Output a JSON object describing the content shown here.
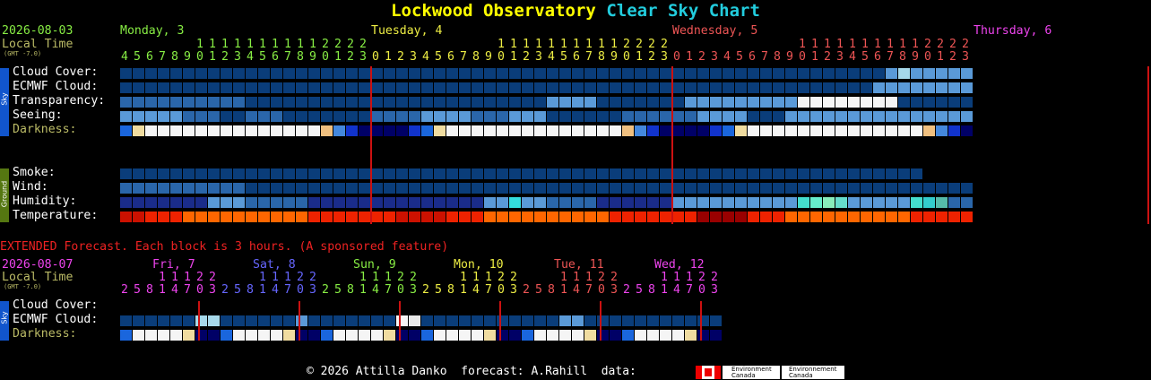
{
  "title": {
    "site": "Lockwood Observatory",
    "suffix": "Clear Sky Chart"
  },
  "main": {
    "date": "2026-08-03",
    "local_time_label": "Local Time",
    "gmt": "(GMT -7.0)",
    "days": [
      {
        "label": "Monday, 3",
        "color": "#88ee44"
      },
      {
        "label": "Tuesday, 4",
        "color": "#eeee44"
      },
      {
        "label": "Wednesday, 5",
        "color": "#ee5555"
      },
      {
        "label": "Thursday, 6",
        "color": "#ee44ee"
      }
    ],
    "hour_start": 4,
    "hour_count": 68,
    "sky_rows": [
      "Cloud Cover:",
      "ECMWF Cloud:",
      "Transparency:",
      "Seeing:",
      "Darkness:"
    ],
    "ground_rows": [
      "Smoke:",
      "Wind:",
      "Humidity:",
      "Temperature:"
    ],
    "sky_side": "Sky",
    "ground_side": "Ground"
  },
  "extended": {
    "heading": "EXTENDED Forecast. Each block is 3 hours. (A sponsored feature)",
    "date": "2026-08-07",
    "local_time_label": "Local Time",
    "gmt": "(GMT -7.0)",
    "days": [
      {
        "label": "Fri, 7",
        "color": "#ee44ee"
      },
      {
        "label": "Sat, 8",
        "color": "#6666ff"
      },
      {
        "label": "Sun, 9",
        "color": "#88ee44"
      },
      {
        "label": "Mon, 10",
        "color": "#eeee44"
      },
      {
        "label": "Tue, 11",
        "color": "#ee5555"
      },
      {
        "label": "Wed, 12",
        "color": "#ee44ee"
      }
    ],
    "hours": [
      "2",
      "5",
      "8",
      "11",
      "14",
      "17",
      "20",
      "23"
    ],
    "rows": [
      "Cloud Cover:",
      "ECMWF Cloud:",
      "Darkness:"
    ],
    "side": "Sky"
  },
  "footer": {
    "text": "© 2026 Attilla Danko  forecast: A.Rahill  data:",
    "logo1": "Environment\nCanada",
    "logo2": "Environnement\nCanada"
  },
  "colors": {
    "title_site": "#ffff00",
    "title_suffix": "#22ccdd",
    "date": "#88ee44",
    "label": "#ffffff",
    "darkness_label": "#bbbb66",
    "local_time": "#bbbb66",
    "midnight_line": "#cc1111",
    "extended_heading": "#ee2222",
    "sky_bar": "#1155cc",
    "ground_bar": "#557711"
  }
}
